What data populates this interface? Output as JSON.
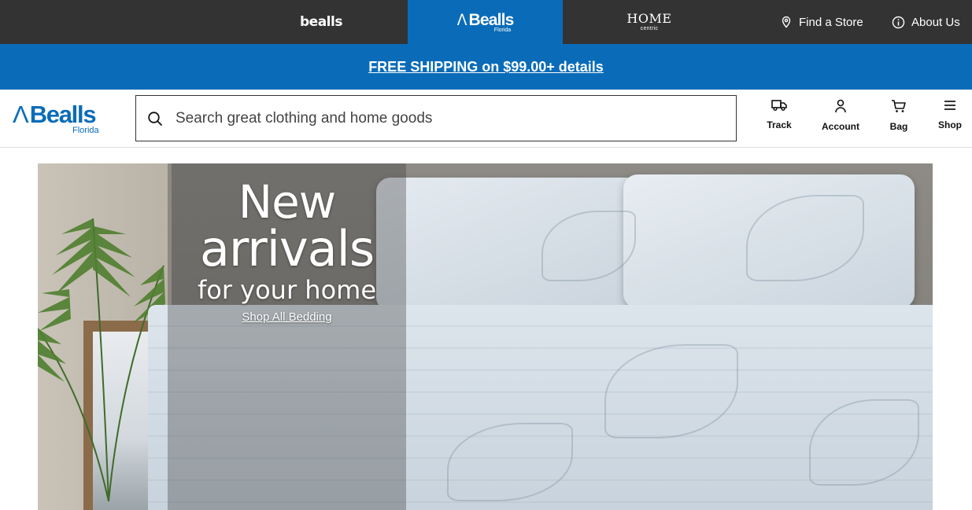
{
  "brands": {
    "bealls": "bealls",
    "florida_mark": "Λ",
    "florida_word": "Bealls",
    "florida_sub": "Florida",
    "home_word": "HOME",
    "home_sub": "centric"
  },
  "utility": {
    "find_store": "Find a Store",
    "about_us": "About Us"
  },
  "promo": {
    "shipping_text": "FREE SHIPPING on $99.00+ details"
  },
  "header": {
    "logo_mark": "Λ",
    "logo_word": "Bealls",
    "logo_sub": "Florida",
    "search_placeholder": "Search great clothing and home goods",
    "actions": {
      "track": "Track",
      "account": "Account",
      "bag": "Bag",
      "shop": "Shop"
    }
  },
  "hero": {
    "line1": "New",
    "line2": "arrivals",
    "line3": "for your home",
    "cta": "Shop All Bedding"
  },
  "colors": {
    "brand_blue": "#0a6cb8",
    "top_bar": "#333333"
  }
}
